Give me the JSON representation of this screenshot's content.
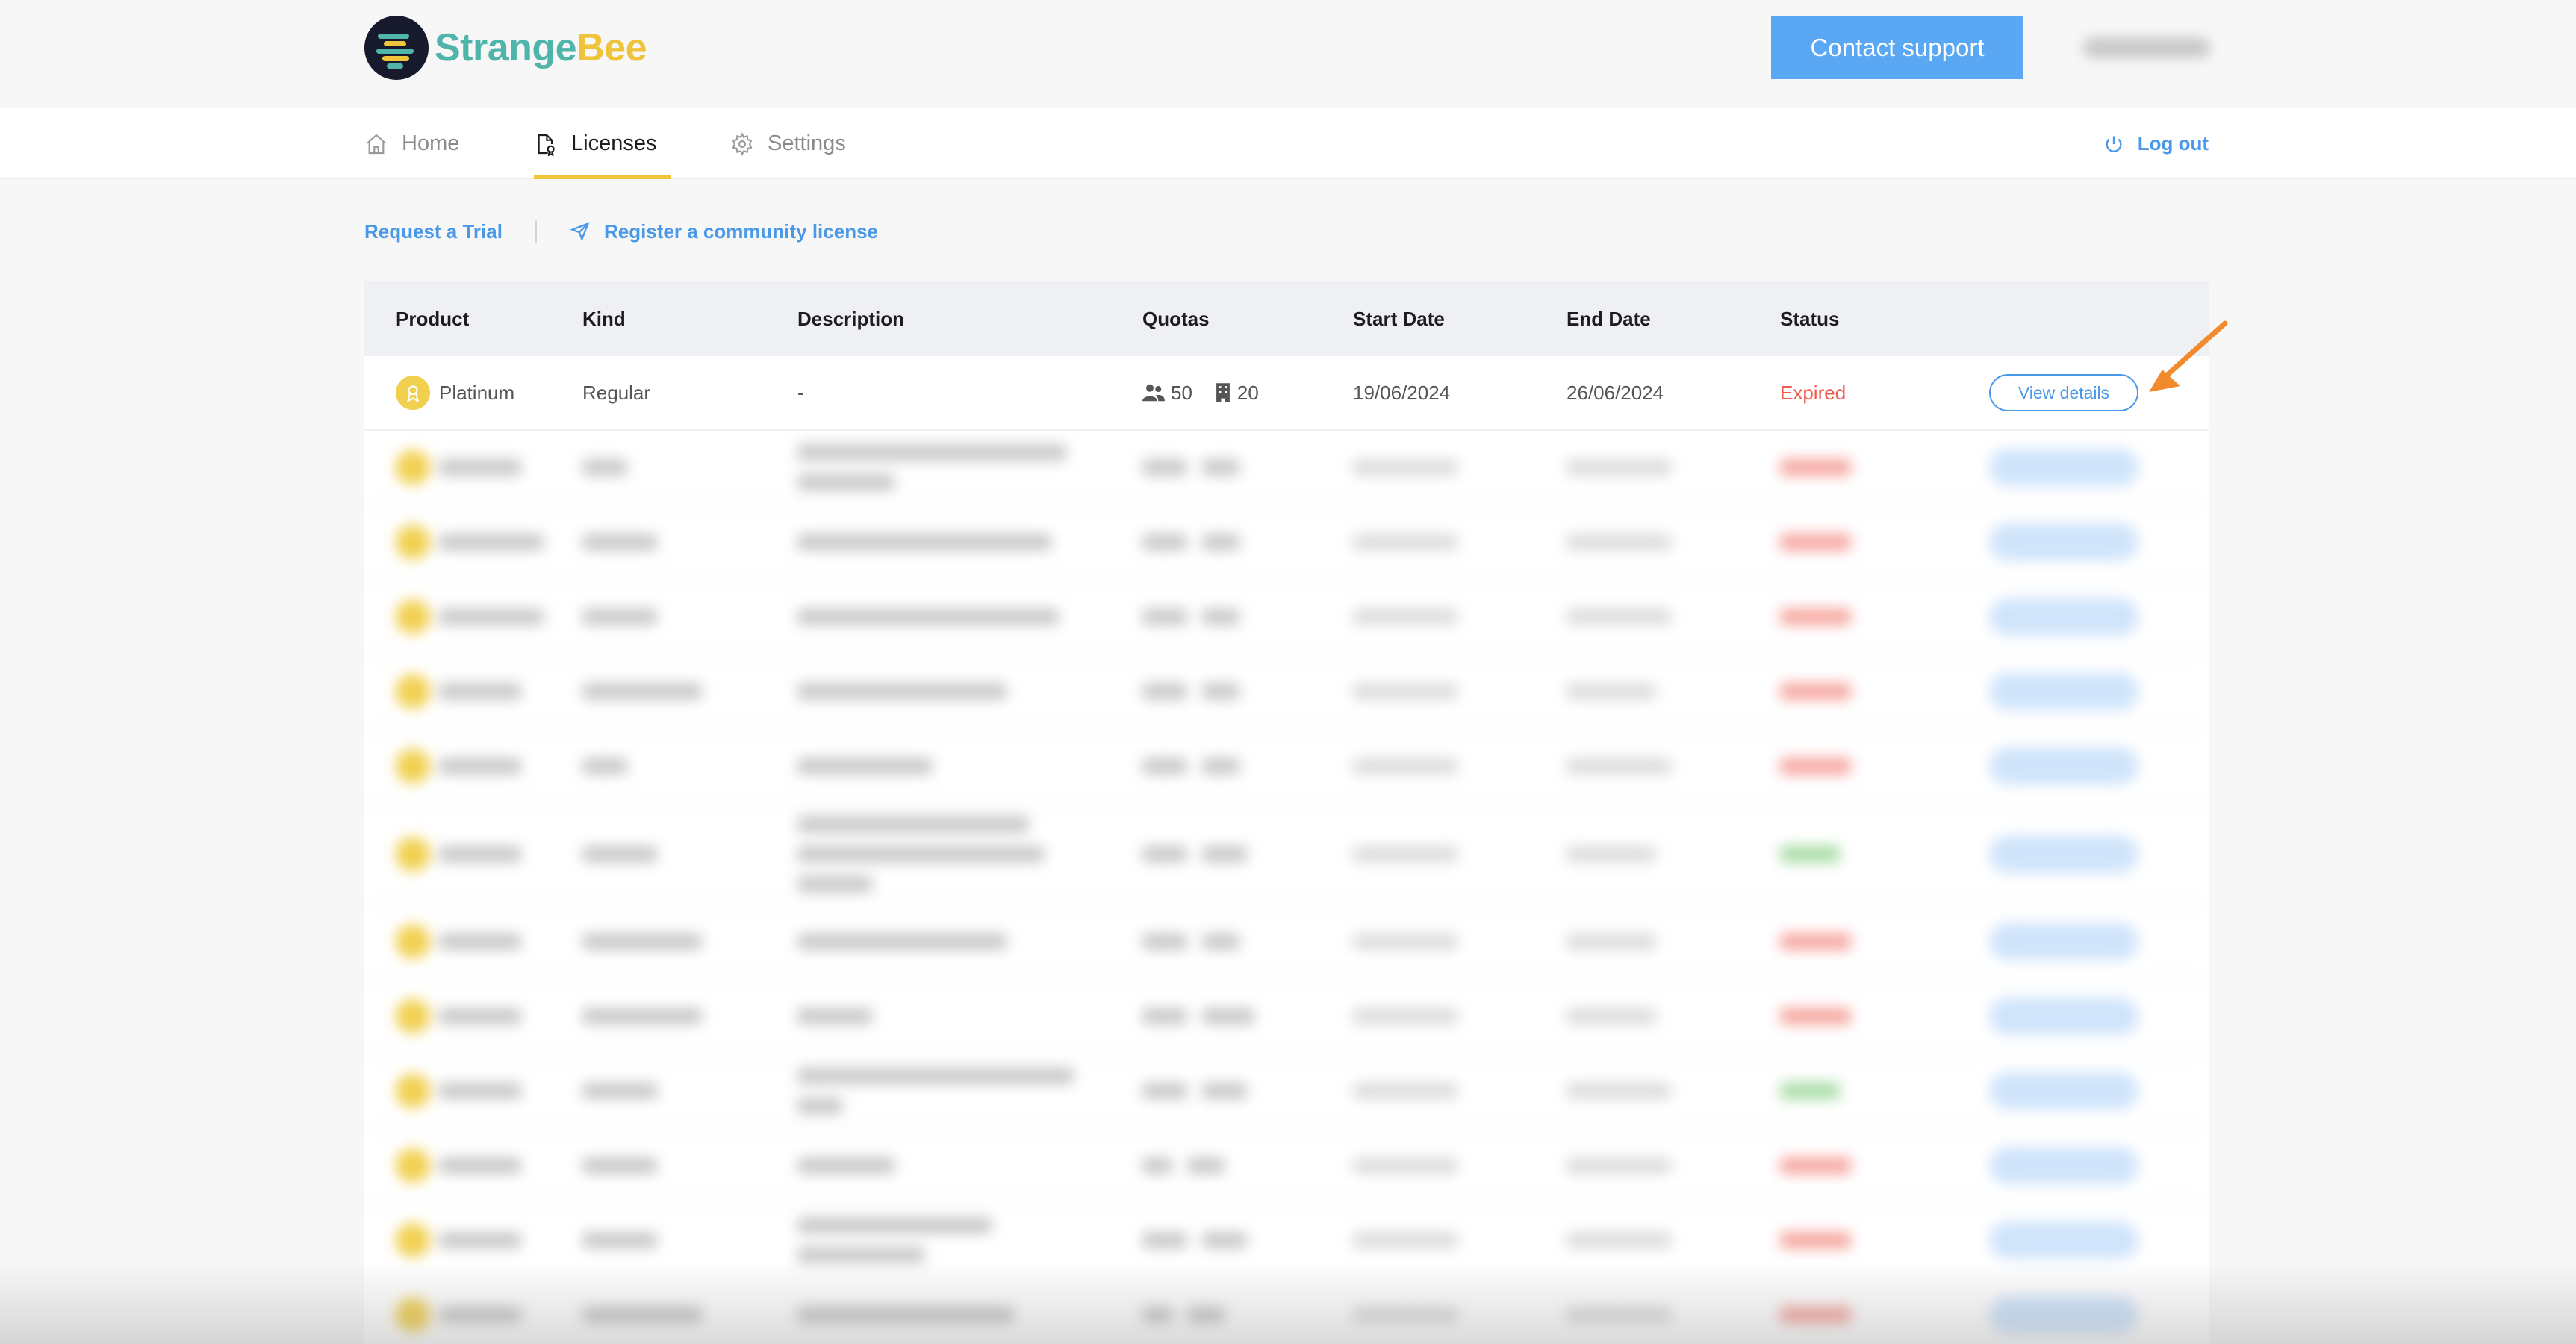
{
  "brand": {
    "name_part1": "Strange",
    "name_part2": "Bee",
    "colors": {
      "teal": "#4fb4aa",
      "yellow": "#efc43a",
      "dark": "#161a2c"
    }
  },
  "header": {
    "contact_label": "Contact support"
  },
  "nav": {
    "items": [
      {
        "label": "Home",
        "icon": "home-icon",
        "active": false
      },
      {
        "label": "Licenses",
        "icon": "license-icon",
        "active": true
      },
      {
        "label": "Settings",
        "icon": "gear-icon",
        "active": false
      }
    ],
    "logout_label": "Log out"
  },
  "actions": {
    "trial_label": "Request a Trial",
    "community_label": "Register a community license"
  },
  "table": {
    "columns": [
      "Product",
      "Kind",
      "Description",
      "Quotas",
      "Start Date",
      "End Date",
      "Status"
    ],
    "rows": [
      {
        "product": "Platinum",
        "kind": "Regular",
        "description": "-",
        "quota_users": "50",
        "quota_orgs": "20",
        "start": "19/06/2024",
        "end": "26/06/2024",
        "status": "Expired",
        "action": "View details"
      }
    ]
  },
  "colors": {
    "accent": "#4a98e8",
    "expired": "#ef5b4f",
    "active": "#5cbf59",
    "highlight_arrow": "#f08a2c"
  }
}
